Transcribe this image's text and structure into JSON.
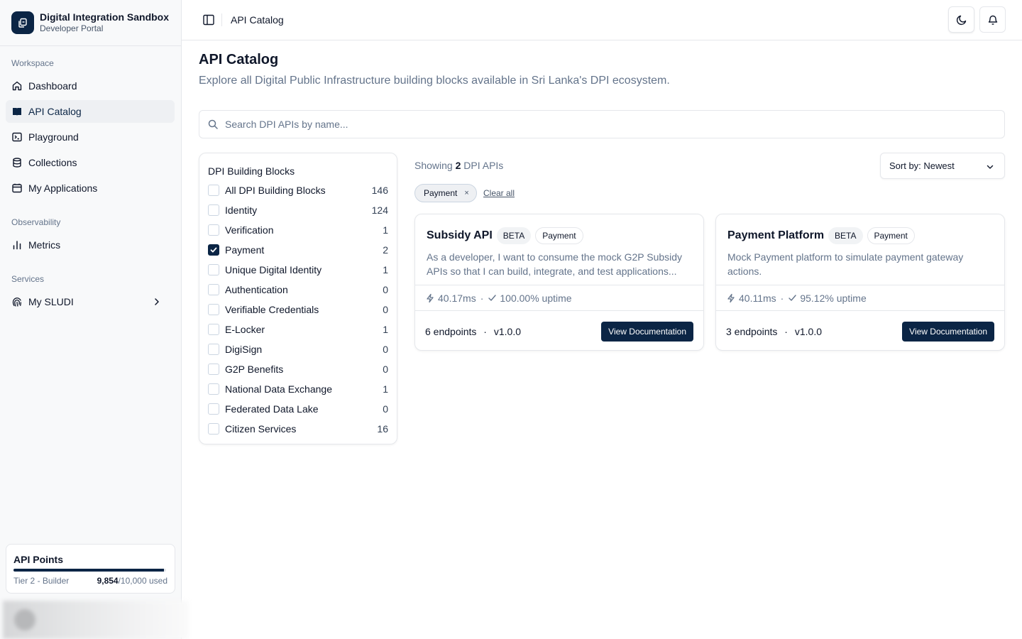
{
  "brand": {
    "title": "Digital Integration Sandbox",
    "subtitle": "Developer Portal"
  },
  "sidebar": {
    "groups": [
      {
        "label": "Workspace"
      },
      {
        "label": "Observability"
      },
      {
        "label": "Services"
      }
    ],
    "items": [
      {
        "label": "Dashboard",
        "icon": "home-icon"
      },
      {
        "label": "API Catalog",
        "icon": "book-icon",
        "active": true
      },
      {
        "label": "Playground",
        "icon": "terminal-icon"
      },
      {
        "label": "Collections",
        "icon": "database-icon"
      },
      {
        "label": "My Applications",
        "icon": "calendar-window-icon"
      },
      {
        "label": "Metrics",
        "icon": "bar-chart-icon"
      },
      {
        "label": "My SLUDI",
        "icon": "fingerprint-icon"
      }
    ]
  },
  "points": {
    "title": "API Points",
    "tier": "Tier 2 - Builder",
    "used": "9,854",
    "total": "/10,000 used",
    "fraction": 0.9854
  },
  "header": {
    "breadcrumb": "API Catalog"
  },
  "main": {
    "title": "API Catalog",
    "subtitle": "Explore all Digital Public Infrastructure building blocks available in Sri Lanka's DPI ecosystem.",
    "search_placeholder": "Search DPI APIs by name...",
    "showing_prefix": "Showing",
    "showing_count": "2",
    "showing_suffix": "DPI APIs",
    "sort_label": "Sort by: Newest",
    "active_chip": "Payment",
    "chip_close": "×",
    "clear_all": "Clear all"
  },
  "filters": {
    "title": "DPI Building Blocks",
    "items": [
      {
        "label": "All DPI Building Blocks",
        "count": "146",
        "checked": false
      },
      {
        "label": "Identity",
        "count": "124",
        "checked": false
      },
      {
        "label": "Verification",
        "count": "1",
        "checked": false
      },
      {
        "label": "Payment",
        "count": "2",
        "checked": true
      },
      {
        "label": "Unique Digital Identity",
        "count": "1",
        "checked": false
      },
      {
        "label": "Authentication",
        "count": "0",
        "checked": false
      },
      {
        "label": "Verifiable Credentials",
        "count": "0",
        "checked": false
      },
      {
        "label": "E-Locker",
        "count": "1",
        "checked": false
      },
      {
        "label": "DigiSign",
        "count": "0",
        "checked": false
      },
      {
        "label": "G2P Benefits",
        "count": "0",
        "checked": false
      },
      {
        "label": "National Data Exchange",
        "count": "1",
        "checked": false
      },
      {
        "label": "Federated Data Lake",
        "count": "0",
        "checked": false
      },
      {
        "label": "Citizen Services",
        "count": "16",
        "checked": false
      }
    ]
  },
  "cards": [
    {
      "name": "Subsidy API",
      "badge": "BETA",
      "category": "Payment",
      "description": "As a developer, I want to consume the mock G2P Subsidy APIs so that I can build, integrate, and test applications...",
      "latency": "40.17ms",
      "uptime": "100.00% uptime",
      "separator": "·",
      "endpoints": "6 endpoints",
      "version": "v1.0.0",
      "button": "View Documentation"
    },
    {
      "name": "Payment Platform",
      "badge": "BETA",
      "category": "Payment",
      "description": "Mock Payment platform to simulate payment gateway actions.",
      "latency": "40.11ms",
      "uptime": "95.12% uptime",
      "separator": "·",
      "endpoints": "3 endpoints",
      "version": "v1.0.0",
      "button": "View Documentation"
    }
  ],
  "colors": {
    "accent": "#0b2545",
    "muted": "#64748b",
    "border": "#e5e7eb"
  }
}
